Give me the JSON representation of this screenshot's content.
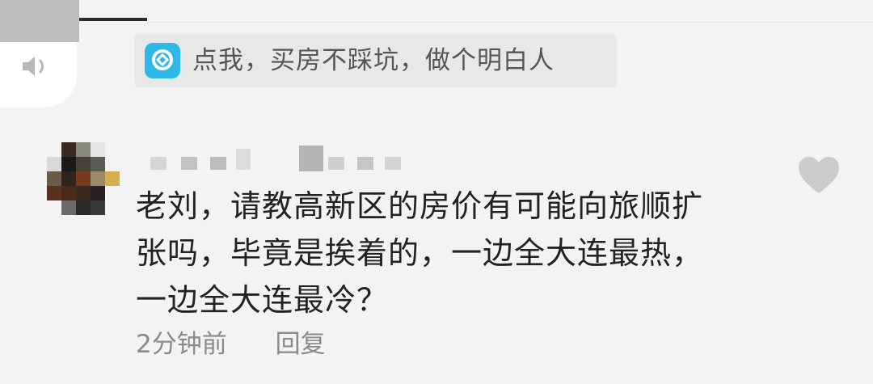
{
  "promo": {
    "text": "点我，买房不踩坑，做个明白人",
    "icon": "app-logo-icon",
    "icon_color": "#2db8e8"
  },
  "comment": {
    "lines": [
      "老刘，请教高新区的房价有可能向旅顺扩",
      "张吗，毕竟是挨着的，一边全大连最热，",
      "一边全大连最冷？"
    ],
    "time": "2分钟前",
    "reply_label": "回复",
    "like_icon": "heart-icon"
  },
  "voice": {
    "icon": "speaker-icon"
  }
}
